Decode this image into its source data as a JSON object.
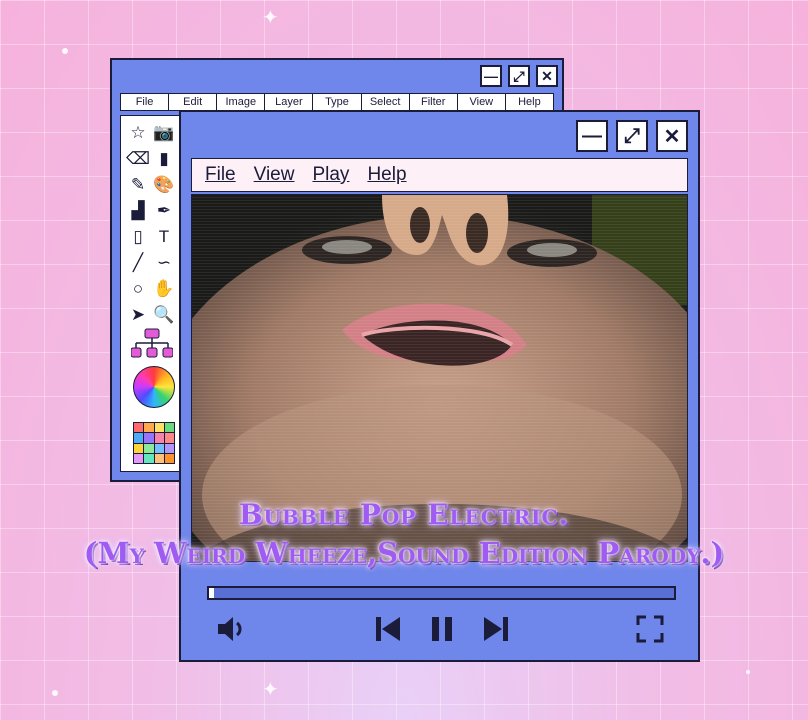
{
  "editor": {
    "menu": [
      "File",
      "Edit",
      "Image",
      "Layer",
      "Type",
      "Select",
      "Filter",
      "View",
      "Help"
    ],
    "window_buttons": {
      "minimize": "—",
      "maximize": "⤢",
      "close": "✕"
    },
    "tools": [
      "☆",
      "📷",
      "⌫",
      "▮",
      "✎",
      "🎨",
      "▟",
      "✒",
      "▯",
      "T",
      "╱",
      "∽",
      "○",
      "✋",
      "➤",
      "🔍"
    ],
    "palette_colors": [
      "#ff6b6b",
      "#ffa94d",
      "#ffe066",
      "#69db7c",
      "#4dabf7",
      "#9775fa",
      "#f783ac",
      "#ff8787",
      "#ffd43b",
      "#8ce99a",
      "#74c0fc",
      "#b197fc",
      "#e599f7",
      "#63e6be",
      "#ffc078",
      "#ff922b"
    ]
  },
  "player": {
    "menu": [
      "File",
      "View",
      "Play",
      "Help"
    ],
    "window_buttons": {
      "minimize": "—",
      "maximize": "⤢",
      "close": "✕"
    },
    "progress": 0.01,
    "icons": {
      "volume": "volume-icon",
      "previous": "skip-back-icon",
      "pause": "pause-icon",
      "next": "skip-forward-icon",
      "fullscreen": "fullscreen-icon"
    }
  },
  "title": {
    "line1": "Bubble Pop Electric.",
    "line2": "(My Weird Wheeze,Sound Edition Parody.)"
  },
  "colors": {
    "background": "#f3b6e2",
    "window_blue": "#6f86ea",
    "outline": "#1b1b3a",
    "title_purple": "#a05cf2"
  }
}
